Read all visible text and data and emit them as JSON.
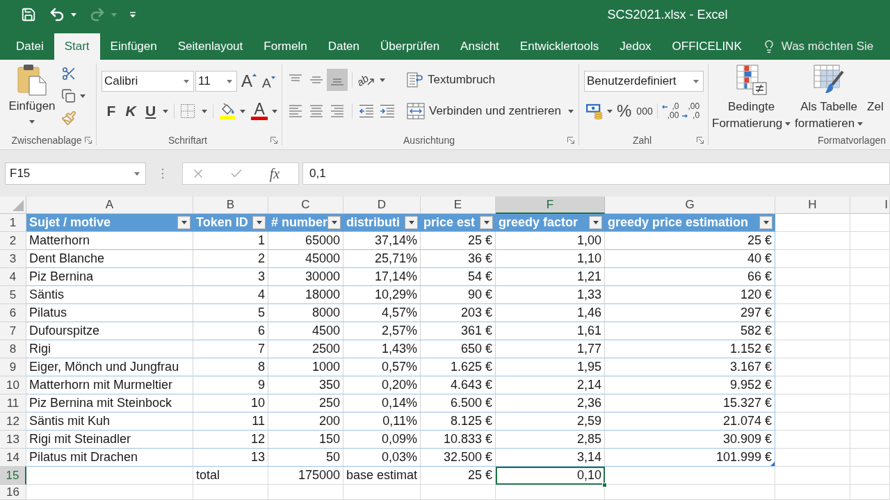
{
  "quick_access": [
    {
      "kind": "save",
      "disabled": false,
      "dropdown": false
    },
    {
      "kind": "undo",
      "disabled": false,
      "dropdown": true
    },
    {
      "kind": "redo",
      "disabled": true,
      "dropdown": true
    },
    {
      "kind": "customize",
      "disabled": false,
      "dropdown": false
    }
  ],
  "window": {
    "title": "SCS2021.xlsx - Excel"
  },
  "tabs": [
    {
      "label": "Datei",
      "selected": false
    },
    {
      "label": "Start",
      "selected": true
    },
    {
      "label": "Einfügen",
      "selected": false
    },
    {
      "label": "Seitenlayout",
      "selected": false
    },
    {
      "label": "Formeln",
      "selected": false
    },
    {
      "label": "Daten",
      "selected": false
    },
    {
      "label": "Überprüfen",
      "selected": false
    },
    {
      "label": "Ansicht",
      "selected": false
    },
    {
      "label": "Entwicklertools",
      "selected": false
    },
    {
      "label": "Jedox",
      "selected": false
    },
    {
      "label": "OFFICELINK",
      "selected": false
    }
  ],
  "tell_me": {
    "placeholder": "Was möchten Sie"
  },
  "ribbon": {
    "clipboard": {
      "label": "Zwischenablage",
      "paste": "Einfügen"
    },
    "font": {
      "label": "Schriftart",
      "font_name": "Calibri",
      "font_size": "11",
      "grow": "A",
      "shrink": "A",
      "bold": "F",
      "italic": "K",
      "underline": "U",
      "font_color": "A"
    },
    "alignment": {
      "label": "Ausrichtung",
      "vertical": [
        {
          "kind": "top",
          "selected": false
        },
        {
          "kind": "middle",
          "selected": false
        },
        {
          "kind": "bottom",
          "selected": true
        }
      ],
      "orientation": "ab",
      "horizontal": [
        {
          "kind": "left",
          "selected": false
        },
        {
          "kind": "center",
          "selected": false
        },
        {
          "kind": "right",
          "selected": false
        }
      ],
      "wrap": "Textumbruch",
      "merge": "Verbinden und zentrieren"
    },
    "number": {
      "label": "Zahl",
      "format": "Benutzerdefiniert",
      "percent": "%",
      "thousands": "000",
      "increase_decimal": [
        ",0",
        ",00"
      ],
      "decrease_decimal": [
        ",00",
        ",0"
      ]
    },
    "styles": {
      "label": "Formatvorlagen",
      "buttons": [
        {
          "kind": "conditional",
          "lines": [
            "Bedingte",
            "Formatierung"
          ],
          "dropdown": true
        },
        {
          "kind": "table",
          "lines": [
            "Als Tabelle",
            "formatieren"
          ],
          "dropdown": true
        },
        {
          "kind": "cell",
          "lines": [
            "Zel"
          ],
          "dropdown": false
        }
      ]
    }
  },
  "formula_bar": {
    "name_box": "F15",
    "function_label": "fx",
    "value": "0,1"
  },
  "sheet": {
    "columns": [
      {
        "label": "A",
        "selected": false
      },
      {
        "label": "B",
        "selected": false
      },
      {
        "label": "C",
        "selected": false
      },
      {
        "label": "D",
        "selected": false
      },
      {
        "label": "E",
        "selected": false
      },
      {
        "label": "F",
        "selected": true
      },
      {
        "label": "G",
        "selected": false
      },
      {
        "label": "H",
        "selected": false
      },
      {
        "label": "I",
        "selected": false
      }
    ],
    "rows": [
      {
        "number": "1",
        "selected": false,
        "kind": "table_header",
        "cells": [
          {
            "text": "Sujet / motive",
            "kind": "text"
          },
          {
            "text": "Token ID",
            "kind": "text"
          },
          {
            "text": "# number",
            "kind": "text"
          },
          {
            "text": "distributi",
            "kind": "text"
          },
          {
            "text": "price est",
            "kind": "text"
          },
          {
            "text": "greedy factor",
            "kind": "text"
          },
          {
            "text": "greedy price estimation",
            "kind": "text"
          }
        ]
      },
      {
        "number": "2",
        "selected": false,
        "kind": "table_row",
        "cells": [
          {
            "text": "Matterhorn",
            "kind": "text"
          },
          {
            "text": "1",
            "kind": "number"
          },
          {
            "text": "65000",
            "kind": "number"
          },
          {
            "text": "37,14%",
            "kind": "number"
          },
          {
            "text": "25 €",
            "kind": "number"
          },
          {
            "text": "1,00",
            "kind": "number"
          },
          {
            "text": "25 €",
            "kind": "number"
          }
        ]
      },
      {
        "number": "3",
        "selected": false,
        "kind": "table_row",
        "cells": [
          {
            "text": "Dent Blanche",
            "kind": "text"
          },
          {
            "text": "2",
            "kind": "number"
          },
          {
            "text": "45000",
            "kind": "number"
          },
          {
            "text": "25,71%",
            "kind": "number"
          },
          {
            "text": "36 €",
            "kind": "number"
          },
          {
            "text": "1,10",
            "kind": "number"
          },
          {
            "text": "40 €",
            "kind": "number"
          }
        ]
      },
      {
        "number": "4",
        "selected": false,
        "kind": "table_row",
        "cells": [
          {
            "text": "Piz Bernina",
            "kind": "text"
          },
          {
            "text": "3",
            "kind": "number"
          },
          {
            "text": "30000",
            "kind": "number"
          },
          {
            "text": "17,14%",
            "kind": "number"
          },
          {
            "text": "54 €",
            "kind": "number"
          },
          {
            "text": "1,21",
            "kind": "number"
          },
          {
            "text": "66 €",
            "kind": "number"
          }
        ]
      },
      {
        "number": "5",
        "selected": false,
        "kind": "table_row",
        "cells": [
          {
            "text": "Säntis",
            "kind": "text"
          },
          {
            "text": "4",
            "kind": "number"
          },
          {
            "text": "18000",
            "kind": "number"
          },
          {
            "text": "10,29%",
            "kind": "number"
          },
          {
            "text": "90 €",
            "kind": "number"
          },
          {
            "text": "1,33",
            "kind": "number"
          },
          {
            "text": "120 €",
            "kind": "number"
          }
        ]
      },
      {
        "number": "6",
        "selected": false,
        "kind": "table_row",
        "cells": [
          {
            "text": "Pilatus",
            "kind": "text"
          },
          {
            "text": "5",
            "kind": "number"
          },
          {
            "text": "8000",
            "kind": "number"
          },
          {
            "text": "4,57%",
            "kind": "number"
          },
          {
            "text": "203 €",
            "kind": "number"
          },
          {
            "text": "1,46",
            "kind": "number"
          },
          {
            "text": "297 €",
            "kind": "number"
          }
        ]
      },
      {
        "number": "7",
        "selected": false,
        "kind": "table_row",
        "cells": [
          {
            "text": "Dufourspitze",
            "kind": "text"
          },
          {
            "text": "6",
            "kind": "number"
          },
          {
            "text": "4500",
            "kind": "number"
          },
          {
            "text": "2,57%",
            "kind": "number"
          },
          {
            "text": "361 €",
            "kind": "number"
          },
          {
            "text": "1,61",
            "kind": "number"
          },
          {
            "text": "582 €",
            "kind": "number"
          }
        ]
      },
      {
        "number": "8",
        "selected": false,
        "kind": "table_row",
        "cells": [
          {
            "text": "Rigi",
            "kind": "text"
          },
          {
            "text": "7",
            "kind": "number"
          },
          {
            "text": "2500",
            "kind": "number"
          },
          {
            "text": "1,43%",
            "kind": "number"
          },
          {
            "text": "650 €",
            "kind": "number"
          },
          {
            "text": "1,77",
            "kind": "number"
          },
          {
            "text": "1.152 €",
            "kind": "number"
          }
        ]
      },
      {
        "number": "9",
        "selected": false,
        "kind": "table_row",
        "cells": [
          {
            "text": "Eiger, Mönch und Jungfrau",
            "kind": "text"
          },
          {
            "text": "8",
            "kind": "number"
          },
          {
            "text": "1000",
            "kind": "number"
          },
          {
            "text": "0,57%",
            "kind": "number"
          },
          {
            "text": "1.625 €",
            "kind": "number"
          },
          {
            "text": "1,95",
            "kind": "number"
          },
          {
            "text": "3.167 €",
            "kind": "number"
          }
        ]
      },
      {
        "number": "10",
        "selected": false,
        "kind": "table_row",
        "cells": [
          {
            "text": "Matterhorn mit Murmeltier",
            "kind": "text"
          },
          {
            "text": "9",
            "kind": "number"
          },
          {
            "text": "350",
            "kind": "number"
          },
          {
            "text": "0,20%",
            "kind": "number"
          },
          {
            "text": "4.643 €",
            "kind": "number"
          },
          {
            "text": "2,14",
            "kind": "number"
          },
          {
            "text": "9.952 €",
            "kind": "number"
          }
        ]
      },
      {
        "number": "11",
        "selected": false,
        "kind": "table_row",
        "cells": [
          {
            "text": "Piz Bernina mit Steinbock",
            "kind": "text"
          },
          {
            "text": "10",
            "kind": "number"
          },
          {
            "text": "250",
            "kind": "number"
          },
          {
            "text": "0,14%",
            "kind": "number"
          },
          {
            "text": "6.500 €",
            "kind": "number"
          },
          {
            "text": "2,36",
            "kind": "number"
          },
          {
            "text": "15.327 €",
            "kind": "number"
          }
        ]
      },
      {
        "number": "12",
        "selected": false,
        "kind": "table_row",
        "cells": [
          {
            "text": "Säntis mit Kuh",
            "kind": "text"
          },
          {
            "text": "11",
            "kind": "number"
          },
          {
            "text": "200",
            "kind": "number"
          },
          {
            "text": "0,11%",
            "kind": "number"
          },
          {
            "text": "8.125 €",
            "kind": "number"
          },
          {
            "text": "2,59",
            "kind": "number"
          },
          {
            "text": "21.074 €",
            "kind": "number"
          }
        ]
      },
      {
        "number": "13",
        "selected": false,
        "kind": "table_row",
        "cells": [
          {
            "text": "Rigi mit Steinadler",
            "kind": "text"
          },
          {
            "text": "12",
            "kind": "number"
          },
          {
            "text": "150",
            "kind": "number"
          },
          {
            "text": "0,09%",
            "kind": "number"
          },
          {
            "text": "10.833 €",
            "kind": "number"
          },
          {
            "text": "2,85",
            "kind": "number"
          },
          {
            "text": "30.909 €",
            "kind": "number"
          }
        ]
      },
      {
        "number": "14",
        "selected": false,
        "kind": "table_row",
        "cells": [
          {
            "text": "Pilatus mit Drachen",
            "kind": "text"
          },
          {
            "text": "13",
            "kind": "number"
          },
          {
            "text": "50",
            "kind": "number"
          },
          {
            "text": "0,03%",
            "kind": "number"
          },
          {
            "text": "32.500 €",
            "kind": "number"
          },
          {
            "text": "3,14",
            "kind": "number"
          },
          {
            "text": "101.999 €",
            "kind": "number"
          }
        ]
      },
      {
        "number": "15",
        "selected": true,
        "kind": "plain",
        "cells": [
          null,
          {
            "text": "total",
            "kind": "text"
          },
          {
            "text": "175000",
            "kind": "number"
          },
          {
            "text": "base estimat",
            "kind": "text"
          },
          {
            "text": "25 €",
            "kind": "number"
          },
          {
            "text": "0,10",
            "kind": "number"
          },
          null
        ]
      },
      {
        "number": "16",
        "selected": false,
        "kind": "plain"
      }
    ]
  }
}
